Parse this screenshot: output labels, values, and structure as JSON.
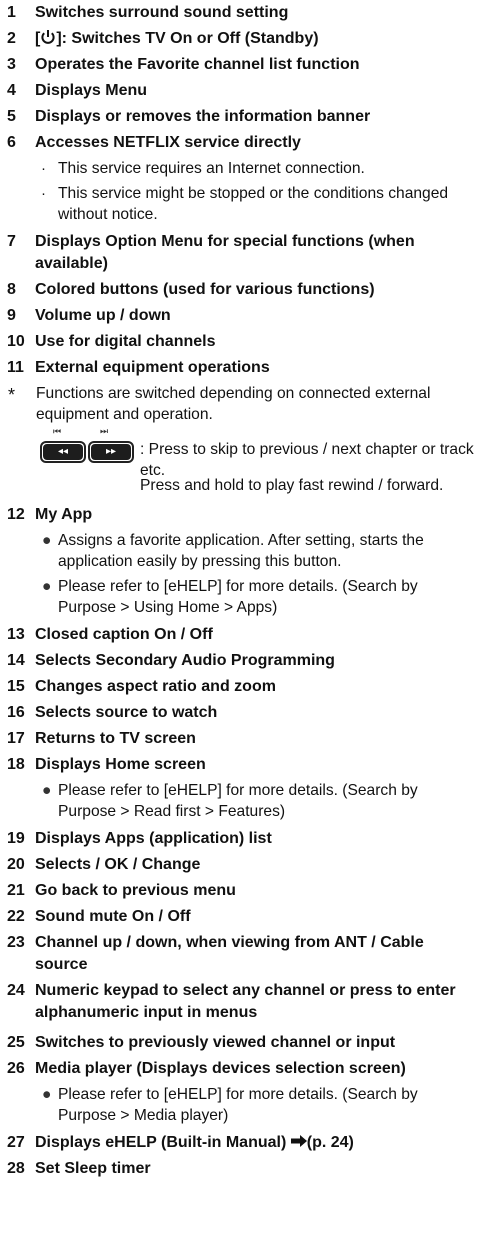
{
  "items": [
    {
      "num": "1",
      "text": "Switches surround sound setting"
    },
    {
      "num": "2",
      "prefix": "[",
      "suffix": "]: Switches TV On or Off (Standby)"
    },
    {
      "num": "3",
      "text": "Operates the Favorite channel list function"
    },
    {
      "num": "4",
      "text": "Displays Menu"
    },
    {
      "num": "5",
      "text": "Displays or removes the information banner"
    },
    {
      "num": "6",
      "text": "Accesses NETFLIX service directly",
      "bullets": [
        "This service requires an Internet connection.",
        "This service might be stopped or the conditions changed without notice."
      ]
    },
    {
      "num": "7",
      "text": "Displays Option Menu for special functions (when available)"
    },
    {
      "num": "8",
      "text": "Colored buttons (used for various functions)"
    },
    {
      "num": "9",
      "text": "Volume up / down"
    },
    {
      "num": "10",
      "text": "Use for digital channels"
    },
    {
      "num": "11",
      "text": "External equipment operations"
    },
    {
      "num": "12",
      "text": "My App",
      "dots": [
        "Assigns a favorite application. After setting, starts the application easily by pressing this button.",
        "Please refer to [eHELP] for more details. (Search by Purpose > Using Home > Apps)"
      ]
    },
    {
      "num": "13",
      "text": "Closed caption On / Off"
    },
    {
      "num": "14",
      "text": "Selects Secondary Audio Programming"
    },
    {
      "num": "15",
      "text": "Changes aspect ratio and zoom"
    },
    {
      "num": "16",
      "text": "Selects source to watch"
    },
    {
      "num": "17",
      "text": "Returns to TV screen"
    },
    {
      "num": "18",
      "text": "Displays Home screen",
      "dots": [
        "Please refer to [eHELP] for more details. (Search by Purpose > Read first > Features)"
      ]
    },
    {
      "num": "19",
      "text": "Displays Apps (application) list"
    },
    {
      "num": "20",
      "text": "Selects / OK / Change"
    },
    {
      "num": "21",
      "text": "Go back to previous menu"
    },
    {
      "num": "22",
      "text": "Sound mute On / Off"
    },
    {
      "num": "23",
      "text": "Channel up / down, when viewing from ANT / Cable source"
    },
    {
      "num": "24",
      "text": "Numeric keypad to select any channel or press to enter alphanumeric input in menus"
    },
    {
      "num": "25",
      "text": "Switches to previously viewed channel or input"
    },
    {
      "num": "26",
      "text": "Media player (Displays devices selection screen)",
      "dots": [
        "Please refer to [eHELP] for more details. (Search by Purpose > Media player)"
      ]
    },
    {
      "num": "27",
      "text": "Displays eHELP (Built-in Manual)",
      "ref": "(p. 24)"
    },
    {
      "num": "28",
      "text": "Set Sleep timer"
    }
  ],
  "note11": {
    "asterisk": "*",
    "text": "Functions are switched depending on connected external equipment and operation.",
    "prev_symbol": "◂◂",
    "next_symbol": "▸▸",
    "prev_top": "⏮",
    "next_top": "⏭",
    "press_skip": ": Press to skip to previous / next chapter or track etc.",
    "press_hold": "Press and hold to play fast rewind / forward."
  },
  "icons": {
    "power": "power-icon",
    "arrow": "arrow-right-icon",
    "bullet": "·",
    "dot": "●"
  }
}
